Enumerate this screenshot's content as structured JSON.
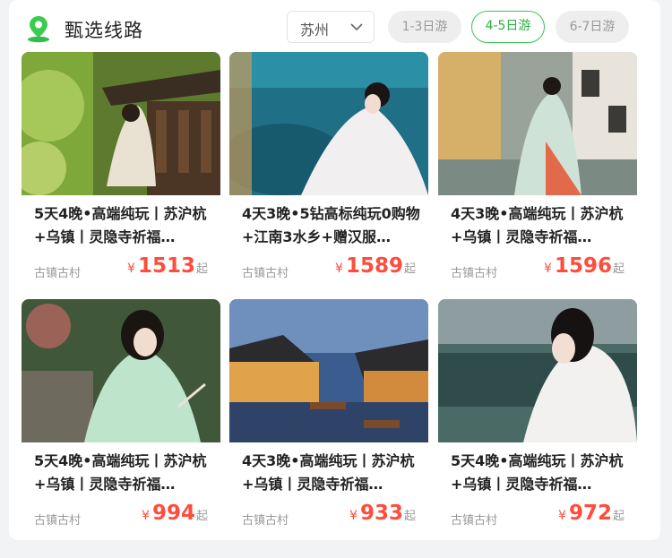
{
  "header": {
    "title": "甄选线路",
    "city": "苏州",
    "filters": [
      {
        "label": "1-3日游",
        "active": false
      },
      {
        "label": "4-5日游",
        "active": true
      },
      {
        "label": "6-7日游",
        "active": false
      }
    ]
  },
  "routes": [
    {
      "name": "5天4晚•高端纯玩丨苏沪杭+乌镇丨灵隐寺祈福…",
      "tag": "古镇古村",
      "currency": "¥",
      "price": "1513",
      "suffix": "起"
    },
    {
      "name": "4天3晚•5钻高标纯玩0购物+江南3水乡+赠汉服…",
      "tag": "古镇古村",
      "currency": "¥",
      "price": "1589",
      "suffix": "起"
    },
    {
      "name": "4天3晚•高端纯玩丨苏沪杭+乌镇丨灵隐寺祈福…",
      "tag": "古镇古村",
      "currency": "¥",
      "price": "1596",
      "suffix": "起"
    },
    {
      "name": "5天4晚•高端纯玩丨苏沪杭+乌镇丨灵隐寺祈福…",
      "tag": "古镇古村",
      "currency": "¥",
      "price": "994",
      "suffix": "起"
    },
    {
      "name": "4天3晚•高端纯玩丨苏沪杭+乌镇丨灵隐寺祈福…",
      "tag": "古镇古村",
      "currency": "¥",
      "price": "933",
      "suffix": "起"
    },
    {
      "name": "5天4晚•高端纯玩丨苏沪杭+乌镇丨灵隐寺祈福…",
      "tag": "古镇古村",
      "currency": "¥",
      "price": "972",
      "suffix": "起"
    }
  ],
  "colors": {
    "accent": "#39c44b",
    "price": "#ff4d3d"
  },
  "icons": {
    "header": "map-pin-icon",
    "city": "chevron-down-icon"
  }
}
